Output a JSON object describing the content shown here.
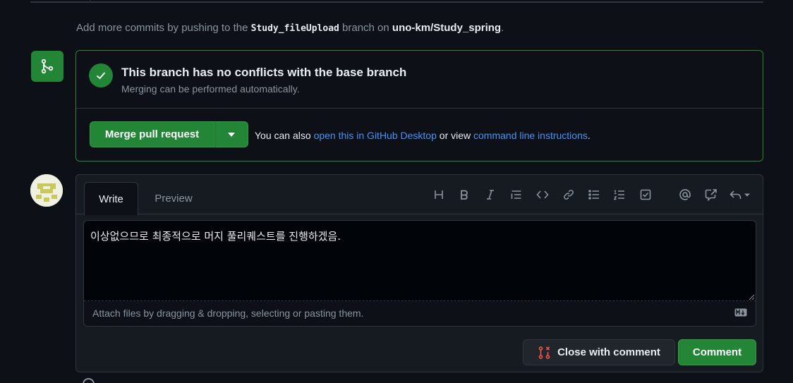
{
  "hint": {
    "prefix": "Add more commits by pushing to the ",
    "branch": "Study_fileUpload",
    "middle": " branch on ",
    "repo": "uno-km/Study_spring",
    "suffix": "."
  },
  "merge": {
    "icon": "git-merge-icon",
    "status_icon": "check-icon",
    "title": "This branch has no conflicts with the base branch",
    "subtitle": "Merging can be performed automatically.",
    "merge_button": "Merge pull request",
    "also_prefix": "You can also ",
    "desktop_link": "open this in GitHub Desktop",
    "also_middle": " or view ",
    "cli_link": "command line instructions",
    "also_suffix": "."
  },
  "comment": {
    "tabs": [
      "Write",
      "Preview"
    ],
    "toolbar": [
      "heading-icon",
      "bold-icon",
      "italic-icon",
      "quote-icon",
      "code-icon",
      "link-icon",
      "bulleted-list-icon",
      "numbered-list-icon",
      "task-list-icon",
      "mention-icon",
      "cross-reference-icon",
      "reply-icon"
    ],
    "text": "이상없으므로 최종적으로 머지 풀리퀘스트를 진행하겠음.",
    "attach_hint": "Attach files by dragging & dropping, selecting or pasting them.",
    "close_button": "Close with comment",
    "comment_button": "Comment"
  },
  "colors": {
    "background": "#0d1117",
    "success": "#238636",
    "link": "#4493f8",
    "danger": "#f85149"
  }
}
